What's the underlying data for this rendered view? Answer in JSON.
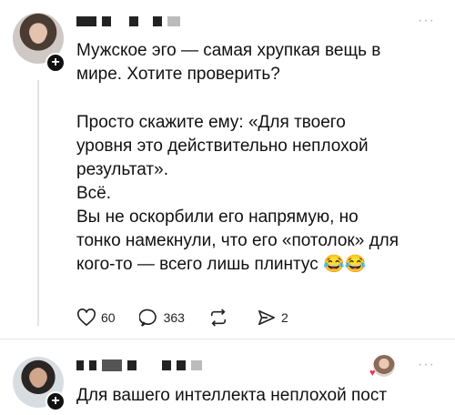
{
  "post1": {
    "more_label": "···",
    "text_lines_1": [
      "Мужское эго — самая хрупкая вещь в",
      "мире. Хотите проверить?"
    ],
    "text_lines_2": [
      "Просто скажите ему: «Для твоего",
      "уровня это действительно неплохой",
      "результат».",
      "Всё.",
      "Вы не оскорбили его напрямую, но",
      "тонко намекнули, что его «потолок» для",
      "кого-то — всего лишь плинтус 😂😂"
    ],
    "actions": {
      "likes": "60",
      "comments": "363",
      "reposts": "",
      "shares": "2"
    }
  },
  "post2": {
    "more_label": "···",
    "text_lines": [
      "Для вашего интеллекта неплохой пост"
    ]
  },
  "icons": {
    "heart": "heart-icon",
    "comment": "comment-icon",
    "repost": "repost-icon",
    "share": "share-icon",
    "follow": "plus-icon"
  },
  "colors": {
    "text": "#111111",
    "muted": "#b5b5b5",
    "like_heart": "#e53950"
  }
}
